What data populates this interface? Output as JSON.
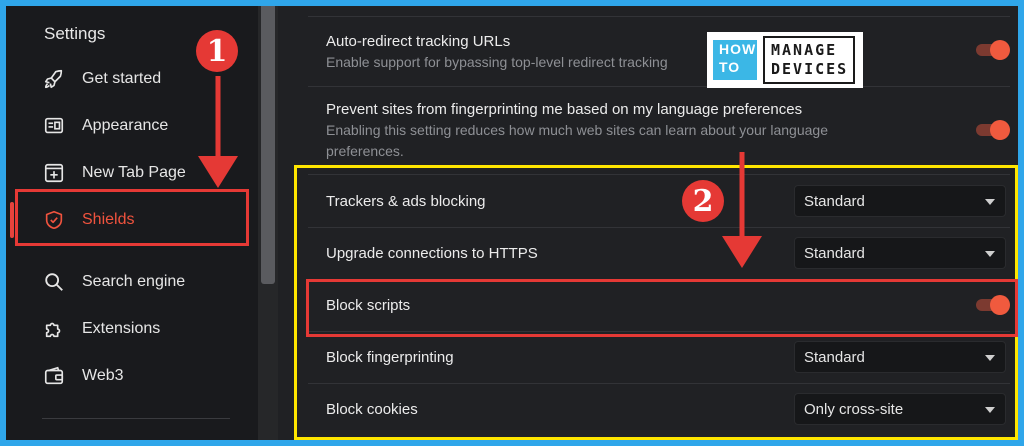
{
  "sidebar": {
    "title": "Settings",
    "items": [
      {
        "label": "Get started",
        "icon": "rocket-icon"
      },
      {
        "label": "Appearance",
        "icon": "appearance-icon"
      },
      {
        "label": "New Tab Page",
        "icon": "new-tab-icon"
      },
      {
        "label": "Shields",
        "icon": "shield-icon",
        "active": true
      },
      {
        "label": "Search engine",
        "icon": "search-icon"
      },
      {
        "label": "Extensions",
        "icon": "puzzle-icon"
      },
      {
        "label": "Web3",
        "icon": "wallet-icon"
      }
    ]
  },
  "main": {
    "auto_redirect": {
      "title": "Auto-redirect tracking URLs",
      "desc": "Enable support for bypassing top-level redirect tracking",
      "enabled": true
    },
    "language_fp": {
      "title": "Prevent sites from fingerprinting me based on my language preferences",
      "desc_line1": "Enabling this setting reduces how much web sites can learn about your language",
      "desc_line2": "preferences.",
      "enabled": true
    },
    "rows": [
      {
        "label": "Trackers & ads blocking",
        "value": "Standard"
      },
      {
        "label": "Upgrade connections to HTTPS",
        "value": "Standard"
      },
      {
        "label": "Block scripts",
        "enabled": true
      },
      {
        "label": "Block fingerprinting",
        "value": "Standard"
      },
      {
        "label": "Block cookies",
        "value": "Only cross-site"
      }
    ]
  },
  "annotations": {
    "step1": "1",
    "step2": "2"
  },
  "logo": {
    "how": "HOW",
    "to": "TO",
    "manage": "MANAGE",
    "devices": "DEVICES"
  },
  "colors": {
    "accent": "#f05a3e",
    "annotation_red": "#e53935",
    "annotation_yellow": "#ffe600",
    "border": "#2fa6ea"
  }
}
